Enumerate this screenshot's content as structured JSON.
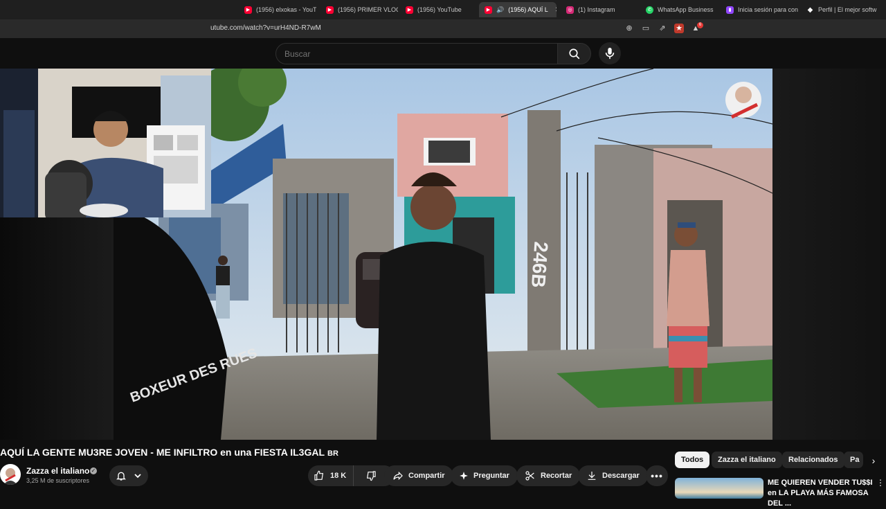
{
  "browser": {
    "tabs": [
      {
        "title": "(1956) elxokas - YouTu",
        "icon": "youtube-icon",
        "color": "#ff0033"
      },
      {
        "title": "(1956) PRIMER VLOG",
        "icon": "youtube-icon",
        "color": "#ff0033"
      },
      {
        "title": "(1956) YouTube",
        "icon": "youtube-icon",
        "color": "#ff0033"
      },
      {
        "title": "(1956) AQUÍ L",
        "icon": "youtube-icon",
        "color": "#ff0033",
        "active": true
      },
      {
        "title": "(1) Instagram",
        "icon": "instagram-icon",
        "color": "#d62976"
      },
      {
        "title": "WhatsApp Business",
        "icon": "whatsapp-icon",
        "color": "#25d366"
      },
      {
        "title": "Inicia sesión para con",
        "icon": "twitch-icon",
        "color": "#9146ff"
      },
      {
        "title": "Perfil | El mejor softw",
        "icon": "diamond-icon",
        "color": "#ffffff"
      }
    ],
    "url": "utube.com/watch?v=urH4ND-R7wM",
    "notification_badge": "6"
  },
  "masthead": {
    "search_placeholder": "Buscar"
  },
  "video": {
    "title": "AQUÍ LA GENTE MU3RE JOVEN - ME INFILTRO en una FIESTA IL3GAL",
    "title_suffix": "BR",
    "shirt_text": "BOXEUR DES RUES",
    "wall_number": "246B"
  },
  "channel": {
    "name": "Zazza el italiano",
    "subscribers": "3,25 M de suscriptores"
  },
  "actions": {
    "likes": "18 K",
    "share": "Compartir",
    "ask": "Preguntar",
    "clip": "Recortar",
    "download": "Descargar"
  },
  "chips": [
    "Todos",
    "Zazza el italiano",
    "Relacionados",
    "Pa"
  ],
  "recommended": {
    "title": "ME QUIEREN VENDER TU$$I en LA PLAYA MÁS FAMOSA DEL ..."
  },
  "colors": {
    "youtube_red": "#ff0033",
    "background": "#0f0f0f",
    "pill": "#272727"
  }
}
